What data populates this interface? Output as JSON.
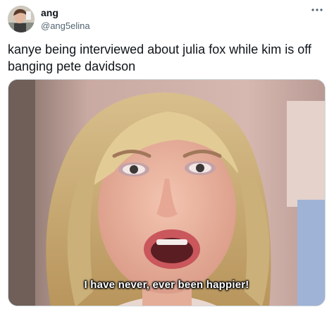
{
  "tweet": {
    "author": {
      "display_name": "ang",
      "handle": "@ang5elina"
    },
    "more_icon": "ellipsis-horizontal-icon",
    "text": "kanye being interviewed about julia fox while kim is off banging pete davidson",
    "media": {
      "subtitle": "I have never, ever been happier!"
    }
  },
  "colors": {
    "text_primary": "#0f1419",
    "text_secondary": "#536471",
    "border": "#cfd9de"
  }
}
